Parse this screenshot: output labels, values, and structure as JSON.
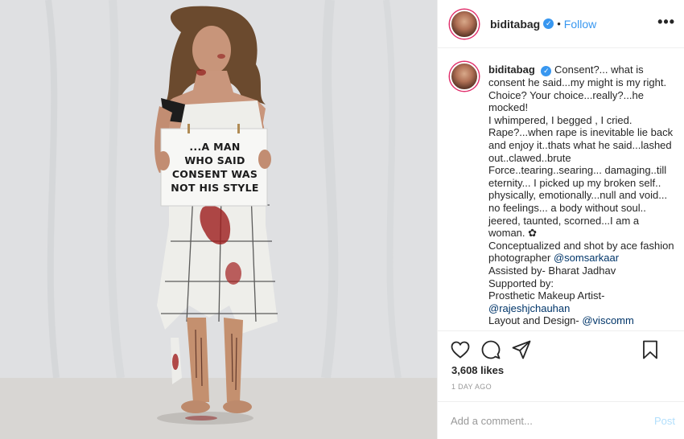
{
  "post": {
    "sign_text": "...A MAN\nWHO SAID\nCONSENT WAS\nNOT HIS STYLE"
  },
  "header": {
    "username": "biditabag",
    "separator": "•",
    "follow_label": "Follow",
    "more_icon": "•••"
  },
  "caption": {
    "username": "biditabag",
    "text_1": "Consent?... what is consent he said...my might is my right. Choice? Your choice...really?...he mocked!\nI whimpered, I begged , I cried. Rape?...when rape is inevitable lie back and enjoy it..thats what he said...lashed out..clawed..brute Force..tearing..searing... damaging..till eternity... I picked up my broken self.. physically, emotionally...null and void... no feelings... a body without soul.. jeered, taunted, scorned...I am a woman. ✿\nConceptualized and shot by ace fashion photographer ",
    "mention_1": "@somsarkaar",
    "text_2": "\nAssisted by- Bharat Jadhav\nSupported by:\nProsthetic Makeup Artist-\n",
    "mention_2": "@rajeshjchauhan",
    "text_3": "\nLayout and Design- ",
    "mention_3": "@viscomm"
  },
  "stats": {
    "likes": "3,608 likes",
    "timestamp": "1 DAY AGO"
  },
  "comment": {
    "placeholder": "Add a comment...",
    "post_label": "Post"
  },
  "icons": {
    "heart": "heart-icon",
    "comment": "comment-icon",
    "share": "share-icon",
    "bookmark": "bookmark-icon",
    "verified": "verified-badge-icon"
  },
  "colors": {
    "link_blue": "#3897f0",
    "mention_blue": "#003569",
    "story_ring": "#e1306c",
    "post_disabled": "#b2dffc"
  }
}
